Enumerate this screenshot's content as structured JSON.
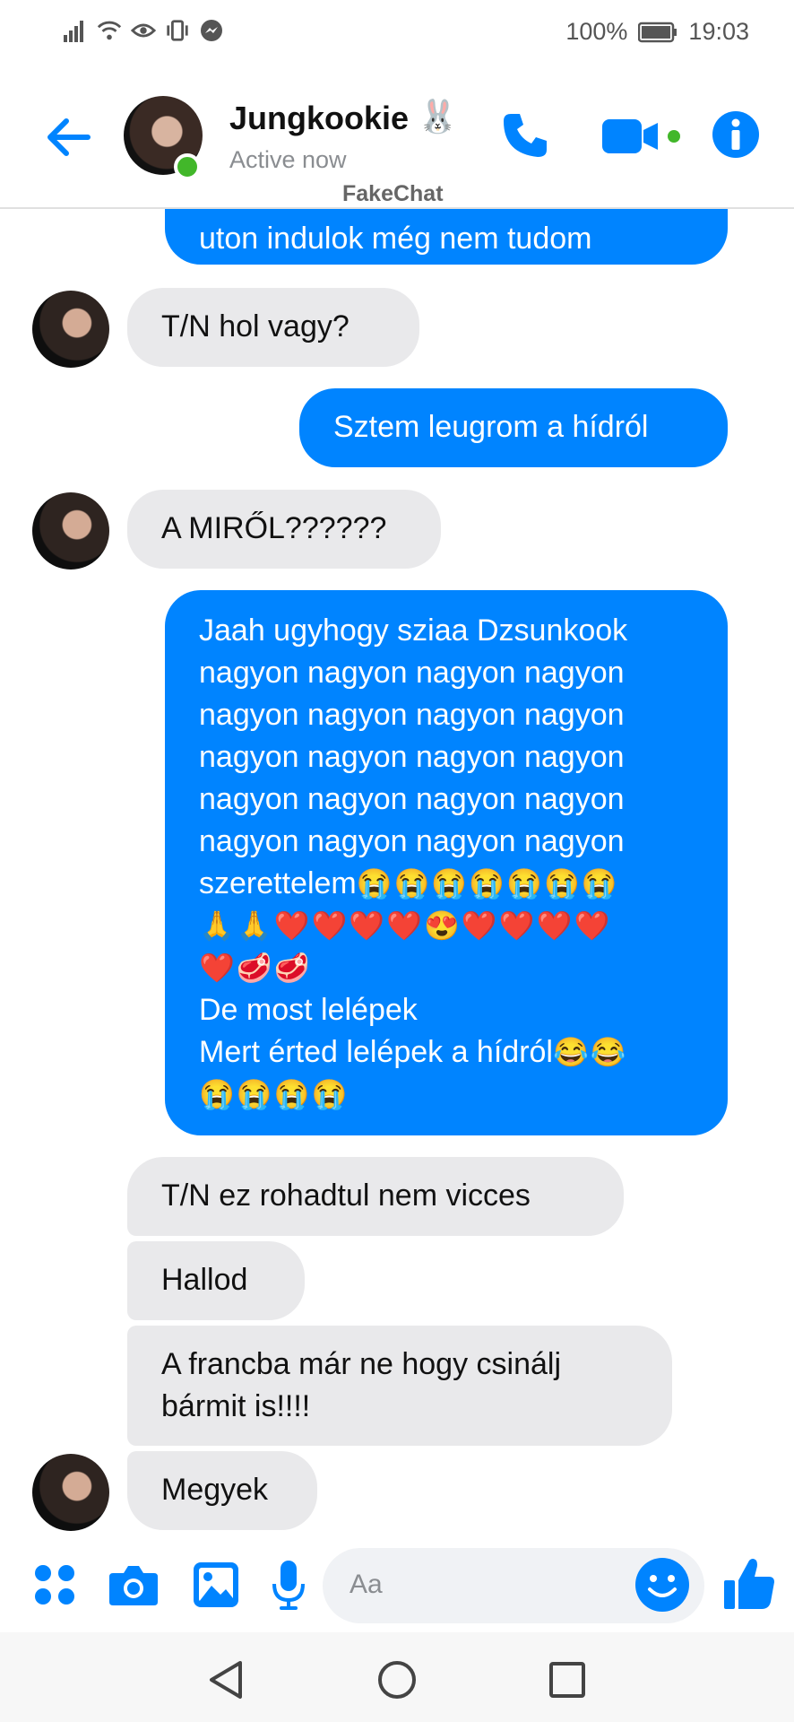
{
  "status_bar": {
    "battery": "100%",
    "time": "19:03"
  },
  "header": {
    "contact_name": "Jungkookie",
    "name_emoji": "🐰",
    "status": "Active now",
    "watermark": "FakeChat",
    "accent_color": "#0084ff",
    "online_color": "#42b72a",
    "icons": [
      "back-arrow-icon",
      "phone-icon",
      "video-icon",
      "info-icon"
    ]
  },
  "messages": [
    {
      "from": "me",
      "text": "uton indulok még nem tudom"
    },
    {
      "from": "them",
      "text": "T/N hol vagy?"
    },
    {
      "from": "me",
      "text": "Sztem leugrom a hídról"
    },
    {
      "from": "them",
      "text": "A MIRŐL??????"
    },
    {
      "from": "me",
      "line1": "Jaah ugyhogy sziaa Dzsunkook",
      "line2": "nagyon nagyon nagyon nagyon",
      "line3": "nagyon nagyon nagyon nagyon",
      "line4": "nagyon nagyon nagyon nagyon",
      "line5": "nagyon nagyon nagyon nagyon",
      "line6": "nagyon nagyon nagyon nagyon",
      "line7_text": "szerettelem",
      "line7_emoji": "😭😭😭😭😭😭😭",
      "line8_emoji": "🙏🙏❤️❤️❤️❤️😍❤️❤️❤️❤️",
      "line9_emoji": "❤️🥩🥩",
      "line10": "De most lelépek",
      "line11_text": "Mert érted lelépek a hídról",
      "line11_emoji": "😂😂",
      "line12_emoji": "😭😭😭😭"
    },
    {
      "from": "them",
      "text": "T/N ez rohadtul nem vicces"
    },
    {
      "from": "them",
      "text": "Hallod"
    },
    {
      "from": "them",
      "line1": "A francba már ne hogy csinálj",
      "line2": "bármit is!!!!"
    },
    {
      "from": "them",
      "text": "Megyek"
    }
  ],
  "composer": {
    "placeholder": "Aa",
    "icons": [
      "apps-icon",
      "camera-icon",
      "gallery-icon",
      "microphone-icon",
      "emoji-icon",
      "thumbs-up-icon"
    ]
  },
  "nav_bar": {
    "icons": [
      "back-triangle-icon",
      "home-circle-icon",
      "recents-square-icon"
    ]
  }
}
